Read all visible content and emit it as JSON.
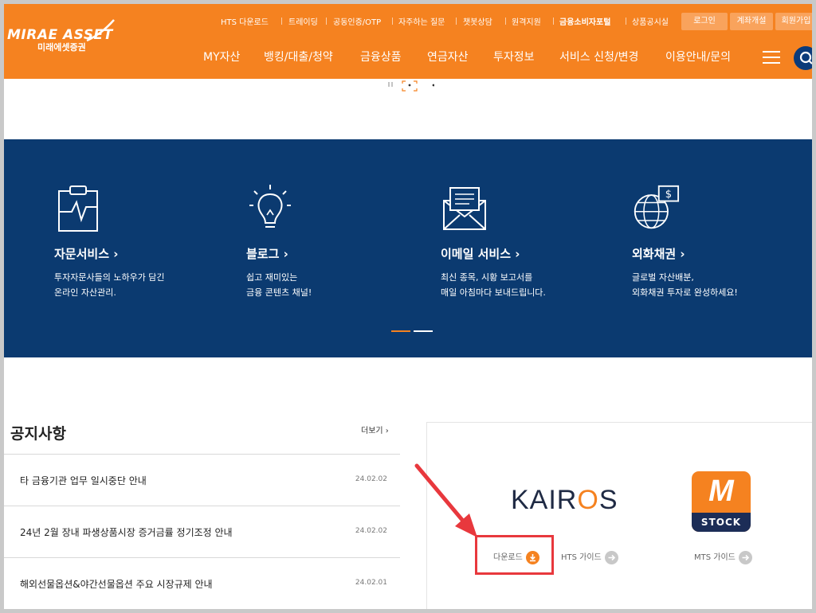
{
  "logo": {
    "en": "MIRAE ASSET",
    "ko": "미래에셋증권"
  },
  "util_links": [
    "HTS 다운로드",
    "트레이딩",
    "공동인증/OTP",
    "자주하는 질문",
    "챗봇상담",
    "원격지원",
    "금융소비자포털",
    "상품공시실"
  ],
  "util_buttons": [
    "로그인",
    "계좌개설",
    "회원가입"
  ],
  "gnb": [
    "MY자산",
    "뱅킹/대출/청약",
    "금융상품",
    "연금자산",
    "투자정보",
    "서비스 신청/변경",
    "이용안내/문의"
  ],
  "services": [
    {
      "title": "자문서비스",
      "desc1": "투자자문사들의 노하우가 담긴",
      "desc2": "온라인 자산관리."
    },
    {
      "title": "블로그",
      "desc1": "쉽고 재미있는",
      "desc2": "금융 콘텐츠 채널!"
    },
    {
      "title": "이메일 서비스",
      "desc1": "최신 종목, 시황 보고서를",
      "desc2": "매일 아침마다 보내드립니다."
    },
    {
      "title": "외화채권",
      "desc1": "글로벌 자산배분,",
      "desc2": "외화채권 투자로 완성하세요!"
    }
  ],
  "notice": {
    "title": "공지사항",
    "more": "더보기",
    "rows": [
      {
        "text": "타 금융기관 업무 일시중단 안내",
        "date": "24.02.02"
      },
      {
        "text": "24년 2월 장내 파생상품시장 증거금률 정기조정 안내",
        "date": "24.02.02"
      },
      {
        "text": "해외선물옵션&야간선물옵션 주요 시장규제 안내",
        "date": "24.02.01"
      }
    ]
  },
  "apps": {
    "kairos": {
      "prefix": "KAIR",
      "o": "O",
      "suffix": "S"
    },
    "mstock": {
      "letter": "M",
      "label": "STOCK"
    },
    "download_label": "다운로드",
    "hts_guide": "HTS 가이드",
    "mts_guide": "MTS 가이드"
  },
  "colors": {
    "brand_orange": "#f58220",
    "banner_navy": "#0b3a70",
    "highlight_red": "#e8383d"
  }
}
